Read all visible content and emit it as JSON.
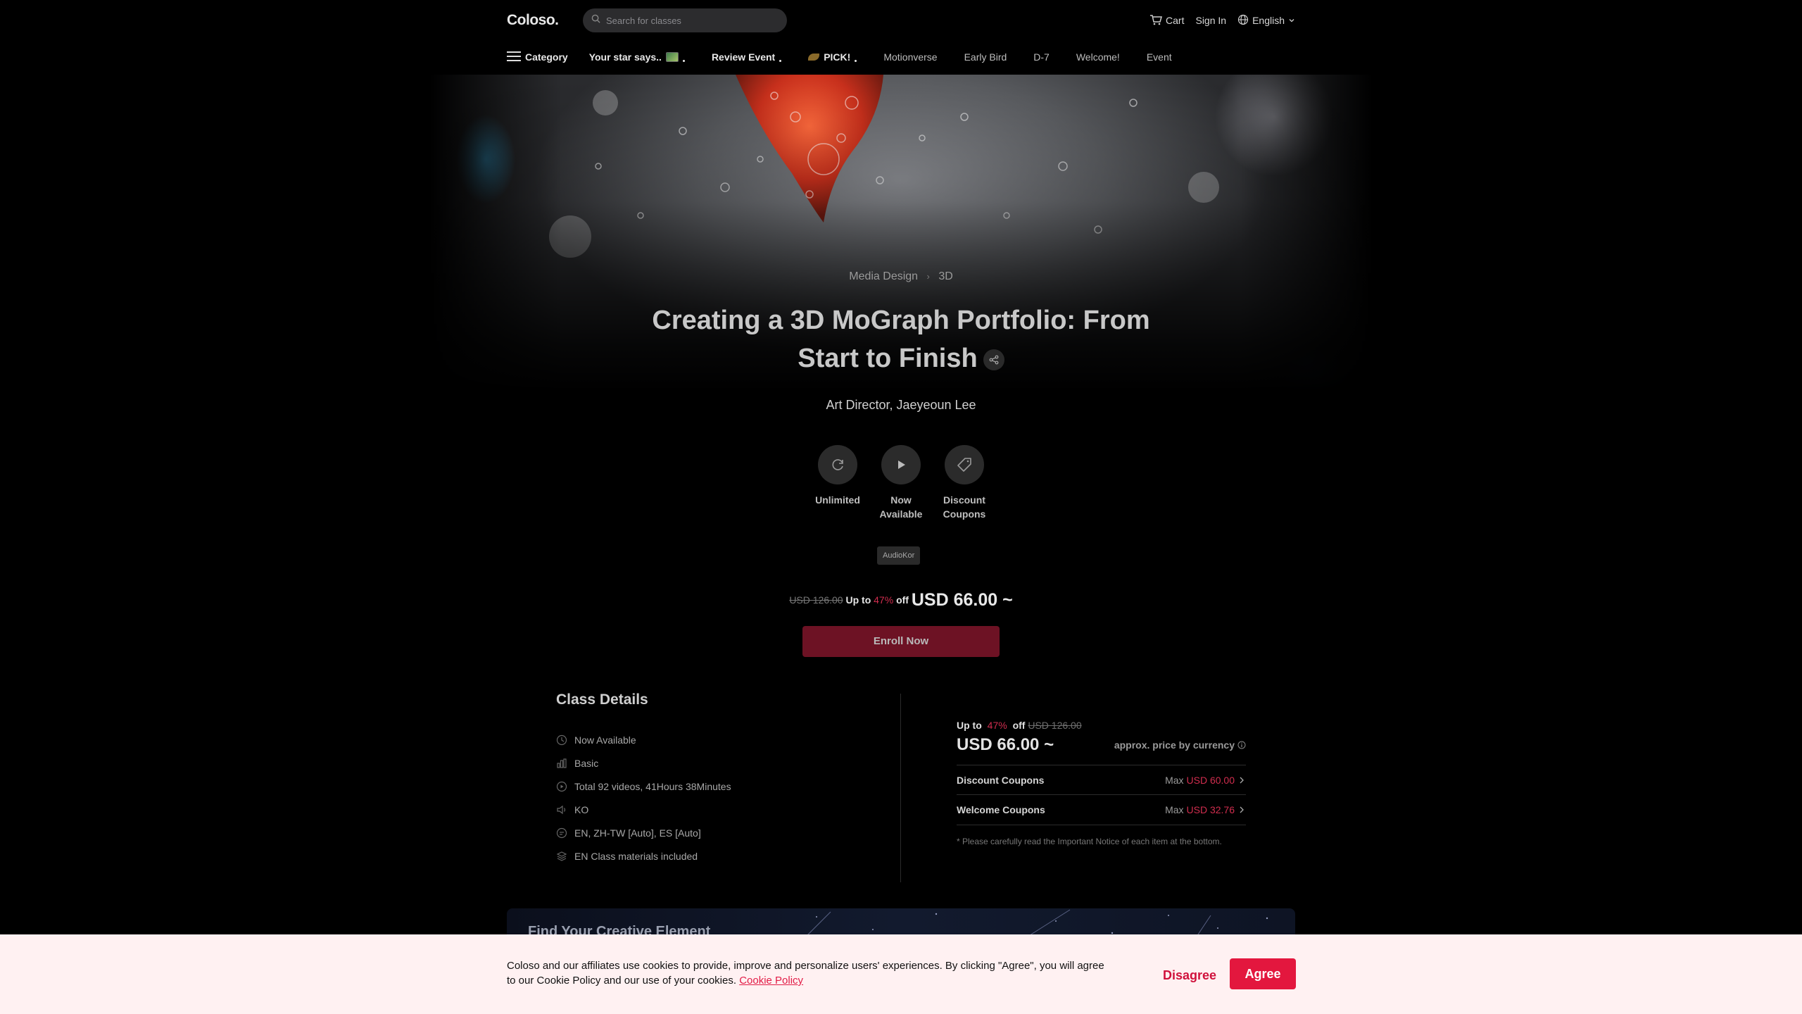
{
  "header": {
    "logo": "Coloso.",
    "search_placeholder": "Search for classes",
    "cart_label": "Cart",
    "signin_label": "Sign In",
    "language_label": "English"
  },
  "nav": {
    "category_label": "Category",
    "items": [
      {
        "label": "Your star says.."
      },
      {
        "label": "Review Event"
      },
      {
        "label": "PICK!"
      },
      {
        "label": "Motionverse"
      },
      {
        "label": "Early Bird"
      },
      {
        "label": "D-7"
      },
      {
        "label": "Welcome!"
      },
      {
        "label": "Event"
      }
    ]
  },
  "hero": {
    "breadcrumb": [
      "Media Design",
      "3D"
    ],
    "title": "Creating a 3D MoGraph Portfolio: From Start to Finish",
    "instructor": "Art Director, Jaeyeoun Lee"
  },
  "features": [
    {
      "icon": "refresh-icon",
      "label": "Unlimited"
    },
    {
      "icon": "play-icon",
      "label": "Now Available"
    },
    {
      "icon": "coupon-tag-icon",
      "label": "Discount Coupons"
    }
  ],
  "audio_tag": "AudioKor",
  "price": {
    "original": "USD 126.00",
    "up_to": "Up to",
    "percent": "47%",
    "off": "off",
    "current": "USD 66.00 ~",
    "enroll_label": "Enroll Now"
  },
  "class_details": {
    "heading": "Class Details",
    "items": [
      {
        "icon": "clock-icon",
        "text": "Now Available"
      },
      {
        "icon": "level-icon",
        "text": "Basic"
      },
      {
        "icon": "video-icon",
        "text": "Total 92 videos, 41Hours 38Minutes"
      },
      {
        "icon": "audio-icon",
        "text": "KO"
      },
      {
        "icon": "subtitle-icon",
        "text": "EN, ZH-TW [Auto], ES [Auto]"
      },
      {
        "icon": "materials-icon",
        "text": "EN Class materials included"
      }
    ]
  },
  "price_box": {
    "approx_label": "approx. price by currency",
    "coupons": [
      {
        "name": "Discount Coupons",
        "max_label": "Max",
        "value": "USD 60.00"
      },
      {
        "name": "Welcome Coupons",
        "max_label": "Max",
        "value": "USD 32.76"
      }
    ],
    "notice": "* Please carefully read the Important Notice of each item at the bottom."
  },
  "banner": {
    "title": "Find Your Creative Element"
  },
  "cookie": {
    "text": "Coloso and our affiliates use cookies to provide, improve and personalize users' experiences. By clicking \"Agree\", you will agree to our Cookie Policy and our use of your cookies.",
    "link_label": "Cookie Policy",
    "disagree_label": "Disagree",
    "agree_label": "Agree"
  },
  "colors": {
    "accent": "#e3173e",
    "discount": "#d02d4e",
    "enroll": "#6d1224"
  }
}
